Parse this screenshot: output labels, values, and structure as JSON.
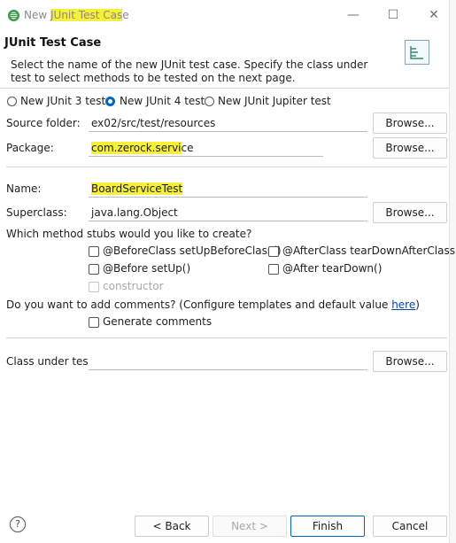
{
  "window": {
    "title_prefix": "New ",
    "title_highlight": "JUnit Test Cas",
    "title_suffix": "e",
    "minimize": "—",
    "maximize": "☐",
    "close": "✕"
  },
  "header": {
    "title": "JUnit Test Case",
    "description": "Select the name of the new JUnit test case. Specify the class under test to select methods to be tested on the next page."
  },
  "version": {
    "options": [
      "New JUnit 3 test",
      "New JUnit 4 test",
      "New JUnit Jupiter test"
    ],
    "selected": "New JUnit 4 test"
  },
  "source_folder": {
    "label": "Source folder:",
    "value": "ex02/src/test/resources",
    "browse": "Browse..."
  },
  "package": {
    "label": "Package:",
    "value_highlight": "com.zerock.servi",
    "value_rest": "ce",
    "browse": "Browse..."
  },
  "name": {
    "label": "Name:",
    "value": "BoardServiceTest"
  },
  "superclass": {
    "label": "Superclass:",
    "value": "java.lang.Object",
    "browse": "Browse..."
  },
  "stubs": {
    "question": "Which method stubs would you like to create?",
    "before_class": "@BeforeClass setUpBeforeClass()",
    "after_class": "@AfterClass tearDownAfterClass()",
    "before": "@Before setUp()",
    "after": "@After tearDown()",
    "constructor": "constructor"
  },
  "comments": {
    "question": "Do you want to add comments? (Configure templates and default value ",
    "link": "here",
    "question_end": ")",
    "generate": "Generate comments"
  },
  "class_under_test": {
    "label": "Class under test:",
    "value": "",
    "browse": "Browse..."
  },
  "buttons": {
    "help": "?",
    "back": "< Back",
    "next": "Next >",
    "finish": "Finish",
    "cancel": "Cancel"
  },
  "colors": {
    "highlight": "#f6f03a",
    "accent": "#0067c0",
    "eclipse_green": "#3aa04a"
  }
}
